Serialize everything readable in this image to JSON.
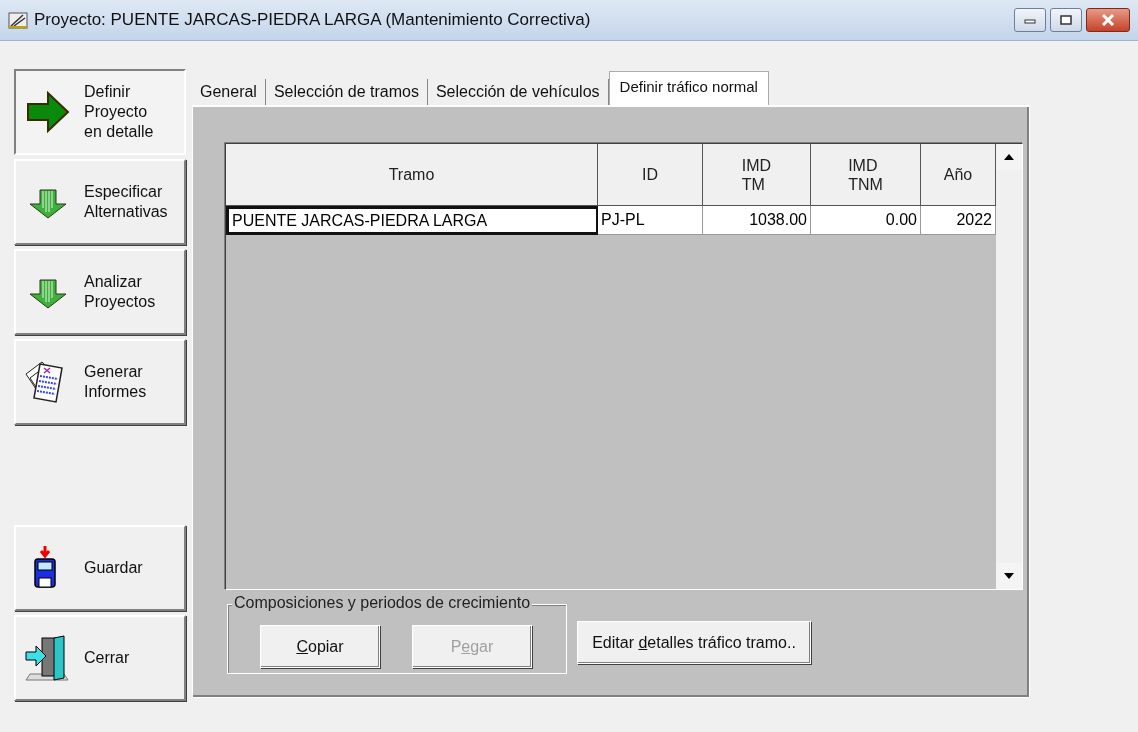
{
  "window": {
    "title": "Proyecto: PUENTE JARCAS-PIEDRA LARGA (Mantenimiento Correctiva)"
  },
  "sidebar": {
    "items": [
      {
        "kind": "arrow",
        "lines": [
          "Definir",
          "Proyecto",
          "en detalle"
        ],
        "selected": true
      },
      {
        "kind": "down",
        "lines": [
          "Especificar",
          "Alternativas"
        ],
        "selected": false
      },
      {
        "kind": "down",
        "lines": [
          "Analizar",
          "Proyectos"
        ],
        "selected": false
      },
      {
        "kind": "report",
        "lines": [
          "Generar",
          "Informes"
        ],
        "selected": false
      }
    ],
    "actions": [
      {
        "kind": "save",
        "label": "Guardar"
      },
      {
        "kind": "close",
        "label": "Cerrar"
      }
    ]
  },
  "tabs": [
    {
      "label": "General",
      "selected": false
    },
    {
      "label": "Selección de tramos",
      "selected": false
    },
    {
      "label": "Selección de vehículos",
      "selected": false
    },
    {
      "label": "Definir tráfico normal",
      "selected": true
    }
  ],
  "table": {
    "columns": [
      {
        "lines": [
          "Tramo"
        ]
      },
      {
        "lines": [
          "ID"
        ]
      },
      {
        "lines": [
          "IMD",
          "TM"
        ]
      },
      {
        "lines": [
          "IMD",
          "TNM"
        ]
      },
      {
        "lines": [
          "Año"
        ]
      }
    ],
    "rows": [
      {
        "cells": [
          "PUENTE JARCAS-PIEDRA LARGA",
          "PJ-PL",
          "1038.00",
          "0.00",
          "2022"
        ]
      }
    ]
  },
  "group": {
    "title": "Composiciones y periodos de crecimiento",
    "buttons": [
      {
        "key": "C",
        "after": "opiar",
        "disabled": false
      },
      {
        "before": "P",
        "key": "e",
        "after": "gar",
        "disabled": true
      }
    ]
  },
  "edit_button": {
    "before": "Editar ",
    "key": "d",
    "after": "etalles tráfico tramo.."
  }
}
